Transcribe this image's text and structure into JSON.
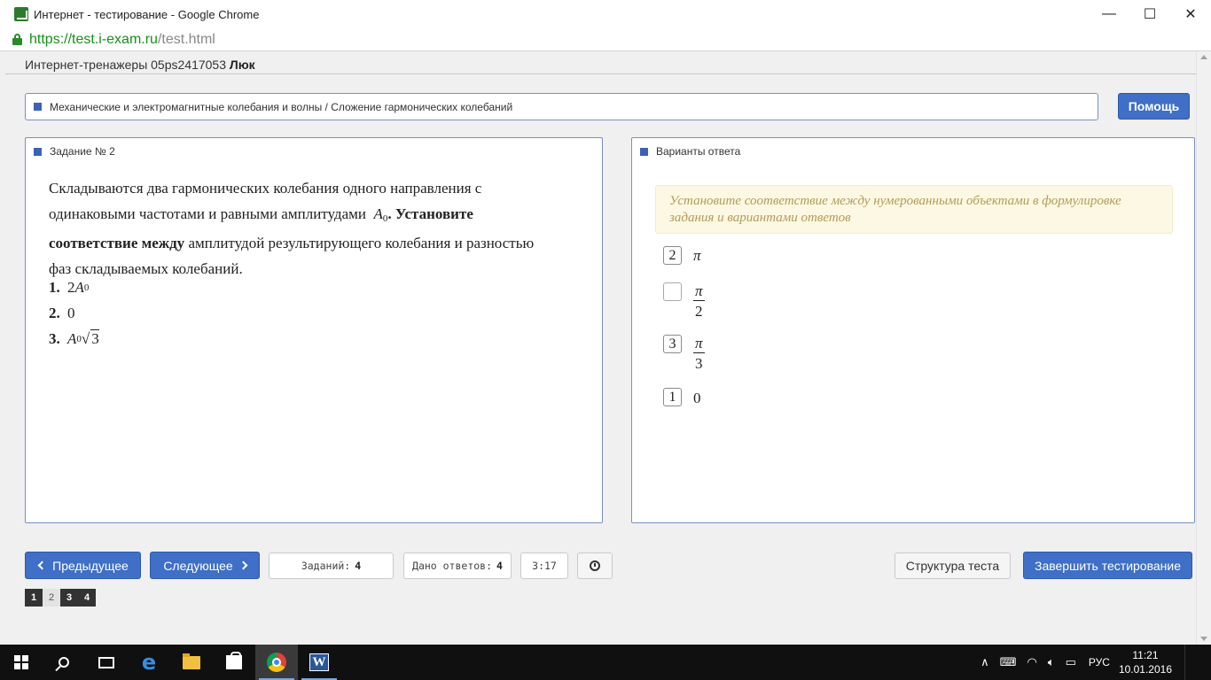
{
  "window": {
    "title": "Интернет - тестирование - Google Chrome",
    "minimize": "—",
    "maximize": "☐",
    "close": "✕"
  },
  "address": {
    "scheme": "https://",
    "host": "test.i-exam.ru",
    "path": "/test.html"
  },
  "header": {
    "prefix": "Интернет-тренажеры 05ps2417053",
    "user": "Люк"
  },
  "breadcrumb": "Механические и электромагнитные колебания и волны / Сложение гармонических колебаний",
  "help_label": "Помощь",
  "task": {
    "title": "Задание № 2",
    "text_1": "Складываются два гармонических колебания одного направления с одинаковыми частотами и равными амплитудами",
    "text_amp": "A",
    "text_amp_sub": "0",
    "text_2": ". Установите соответствие между",
    "text_2_normal_tail": " амплитудой результирующего колебания и разностью фаз складываемых колебаний.",
    "items": [
      {
        "num": "1.",
        "coef": "2",
        "var": "A",
        "sub": "0",
        "root": ""
      },
      {
        "num": "2.",
        "coef": "0",
        "var": "",
        "sub": "",
        "root": ""
      },
      {
        "num": "3.",
        "coef": "",
        "var": "A",
        "sub": "0",
        "root": "3"
      }
    ]
  },
  "answers": {
    "title": "Варианты ответа",
    "hint": "Установите соответствие между нумерованными объектами в формулировке задания и вариантами ответов",
    "rows": [
      {
        "box": "2",
        "value": "π",
        "denom": ""
      },
      {
        "box": "",
        "value": "π",
        "denom": "2"
      },
      {
        "box": "3",
        "value": "π",
        "denom": "3"
      },
      {
        "box": "1",
        "value": "0",
        "denom": ""
      }
    ]
  },
  "controls": {
    "prev": "Предыдущее",
    "next": "Следующее",
    "tasks_label": "Заданий:",
    "tasks_value": "4",
    "answered_label": "Дано ответов:",
    "answered_value": "4",
    "timer": "3:17",
    "structure": "Структура теста",
    "finish": "Завершить тестирование"
  },
  "pager": [
    "1",
    "2",
    "3",
    "4"
  ],
  "taskbar": {
    "tray_lang": "РУС",
    "time": "11:21",
    "date": "10.01.2016"
  },
  "colors": {
    "accent": "#3f6fc6",
    "panel_border": "#7a8fbf",
    "hint_bg": "#fcf8e3",
    "hint_text": "#b39a5a",
    "url_green": "#1a8f1a"
  }
}
